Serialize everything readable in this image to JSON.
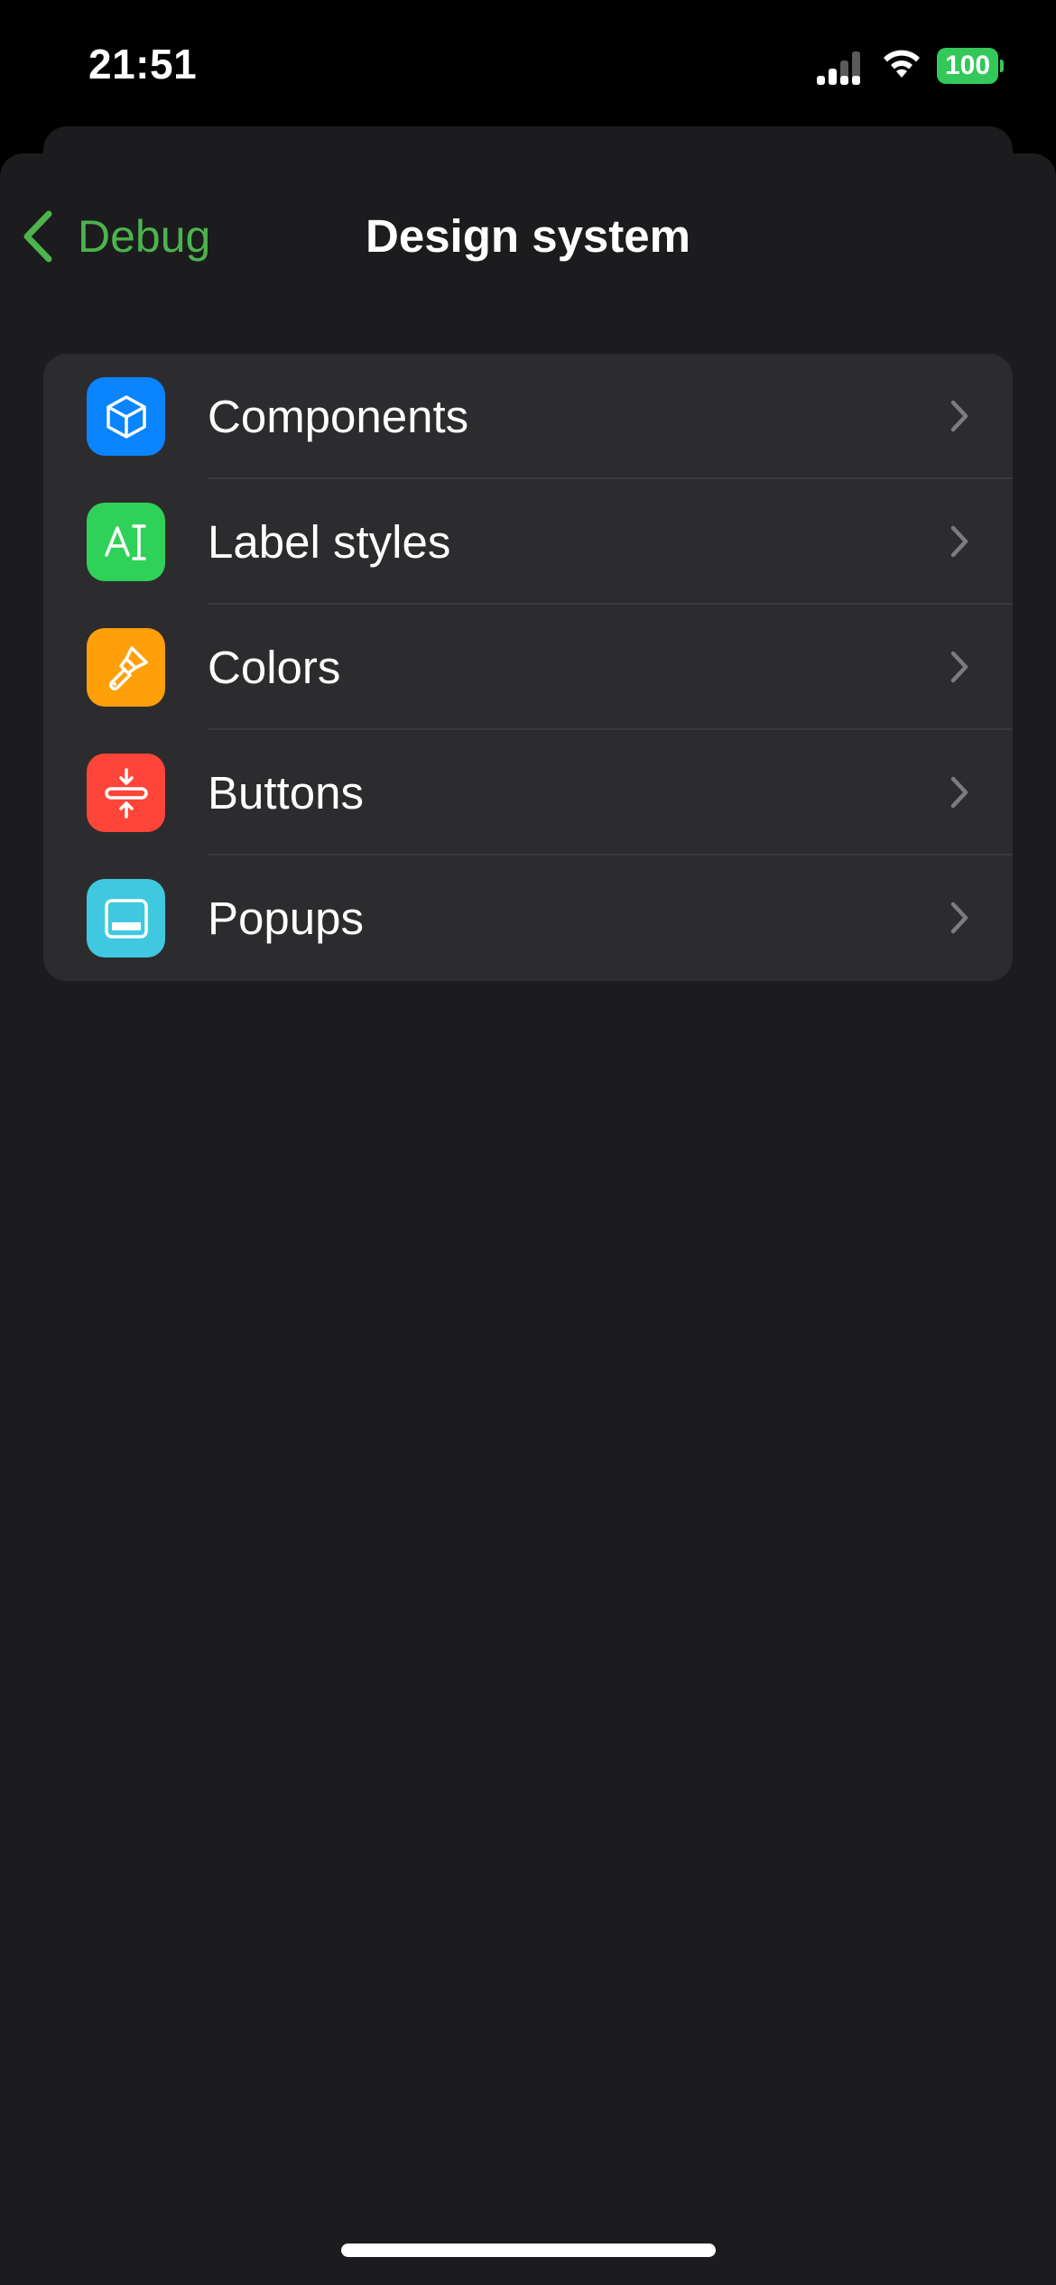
{
  "status_bar": {
    "time": "21:51",
    "battery": "100",
    "signal_icon": "cellular-signal-icon",
    "wifi_icon": "wifi-icon"
  },
  "nav": {
    "back_label": "Debug",
    "title": "Design system",
    "accent_color": "#4cb34d"
  },
  "items": [
    {
      "label": "Components",
      "icon": "cube-icon",
      "color": "#0a84ff"
    },
    {
      "label": "Label styles",
      "icon": "text-cursor-icon",
      "color": "#30d158"
    },
    {
      "label": "Colors",
      "icon": "paintbrush-icon",
      "color": "#ff9f0a"
    },
    {
      "label": "Buttons",
      "icon": "button-compress-icon",
      "color": "#ff453a"
    },
    {
      "label": "Popups",
      "icon": "bottom-sheet-icon",
      "color": "#40c8e0"
    }
  ]
}
